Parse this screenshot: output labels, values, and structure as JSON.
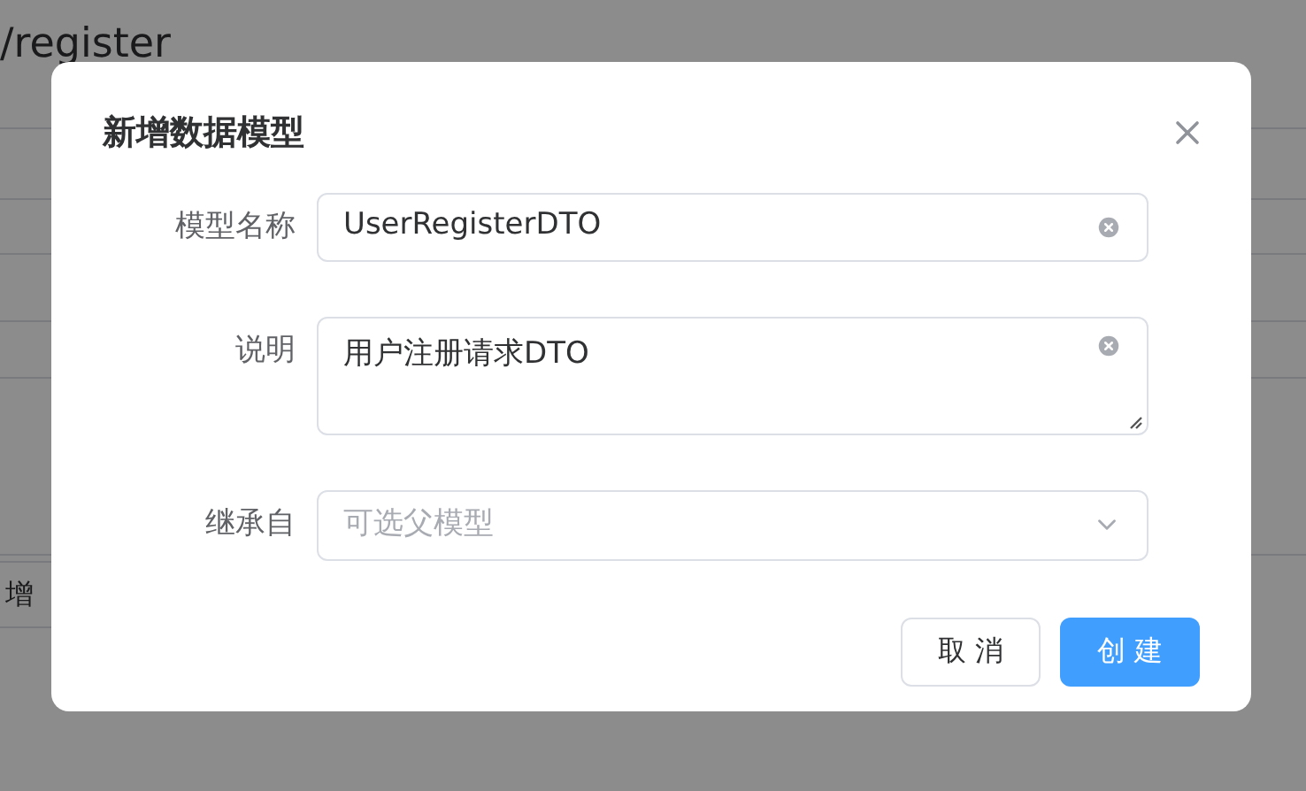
{
  "page": {
    "title": "/register",
    "button_partial": "增"
  },
  "dialog": {
    "title": "新增数据模型",
    "fields": [
      {
        "kind": "input",
        "label": "模型名称",
        "value": "UserRegisterDTO",
        "clearable": true
      },
      {
        "kind": "textarea",
        "label": "说明",
        "value": "用户注册请求DTO",
        "clearable": true
      },
      {
        "kind": "select",
        "label": "继承自",
        "placeholder": "可选父模型"
      }
    ],
    "buttons": [
      {
        "label": "取 消",
        "primary": false
      },
      {
        "label": "创 建",
        "primary": true
      }
    ]
  }
}
